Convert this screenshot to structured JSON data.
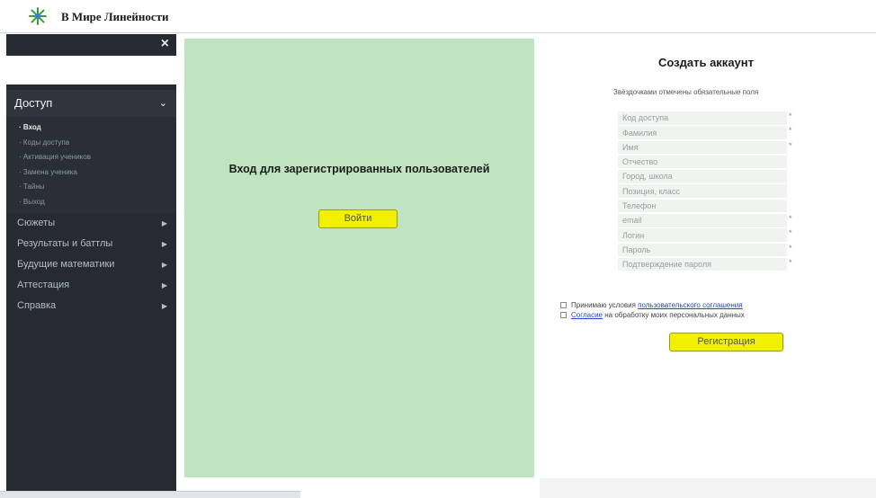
{
  "header": {
    "site_title": "В Мире Линейности",
    "logo_icon": "sprout-logo-icon"
  },
  "sidebar": {
    "close_label": "×",
    "section": {
      "label": "Доступ",
      "items": [
        {
          "label": "Вход",
          "active": true
        },
        {
          "label": "Коды доступа",
          "active": false
        },
        {
          "label": "Активация учеников",
          "active": false
        },
        {
          "label": "Замена ученика",
          "active": false
        },
        {
          "label": "Тайны",
          "active": false
        },
        {
          "label": "Выход",
          "active": false
        }
      ]
    },
    "menu": [
      {
        "label": "Сюжеты"
      },
      {
        "label": "Результаты и баттлы"
      },
      {
        "label": "Будущие математики"
      },
      {
        "label": "Аттестация"
      },
      {
        "label": "Справка"
      }
    ]
  },
  "login": {
    "title": "Вход для зарегистрированных пользователей",
    "button": "Войти",
    "bg_color": "#c0e4bf"
  },
  "register": {
    "title": "Создать аккаунт",
    "note": "Звёздочками отмечены обязательные поля",
    "fields": [
      {
        "placeholder": "Код доступа",
        "required": "*"
      },
      {
        "placeholder": "Фамилия",
        "required": "*"
      },
      {
        "placeholder": "Имя",
        "required": "*"
      },
      {
        "placeholder": "Отчество",
        "required": ""
      },
      {
        "placeholder": "Город, школа",
        "required": ""
      },
      {
        "placeholder": "Позиция, класс",
        "required": ""
      },
      {
        "placeholder": "Телефон",
        "required": ""
      },
      {
        "placeholder": "email",
        "required": "*"
      },
      {
        "placeholder": "Логин",
        "required": "*"
      },
      {
        "placeholder": "Пароль",
        "required": "*"
      },
      {
        "placeholder": "Подтверждение пароля",
        "required": "*"
      }
    ],
    "agree_prefix": "Принимаю условия",
    "agree_link": "пользовательского соглашения",
    "consent_link": "Согласие",
    "consent_suffix": "на обработку моих персональных данных",
    "button": "Регистрация",
    "button_color": "#f0f000"
  }
}
